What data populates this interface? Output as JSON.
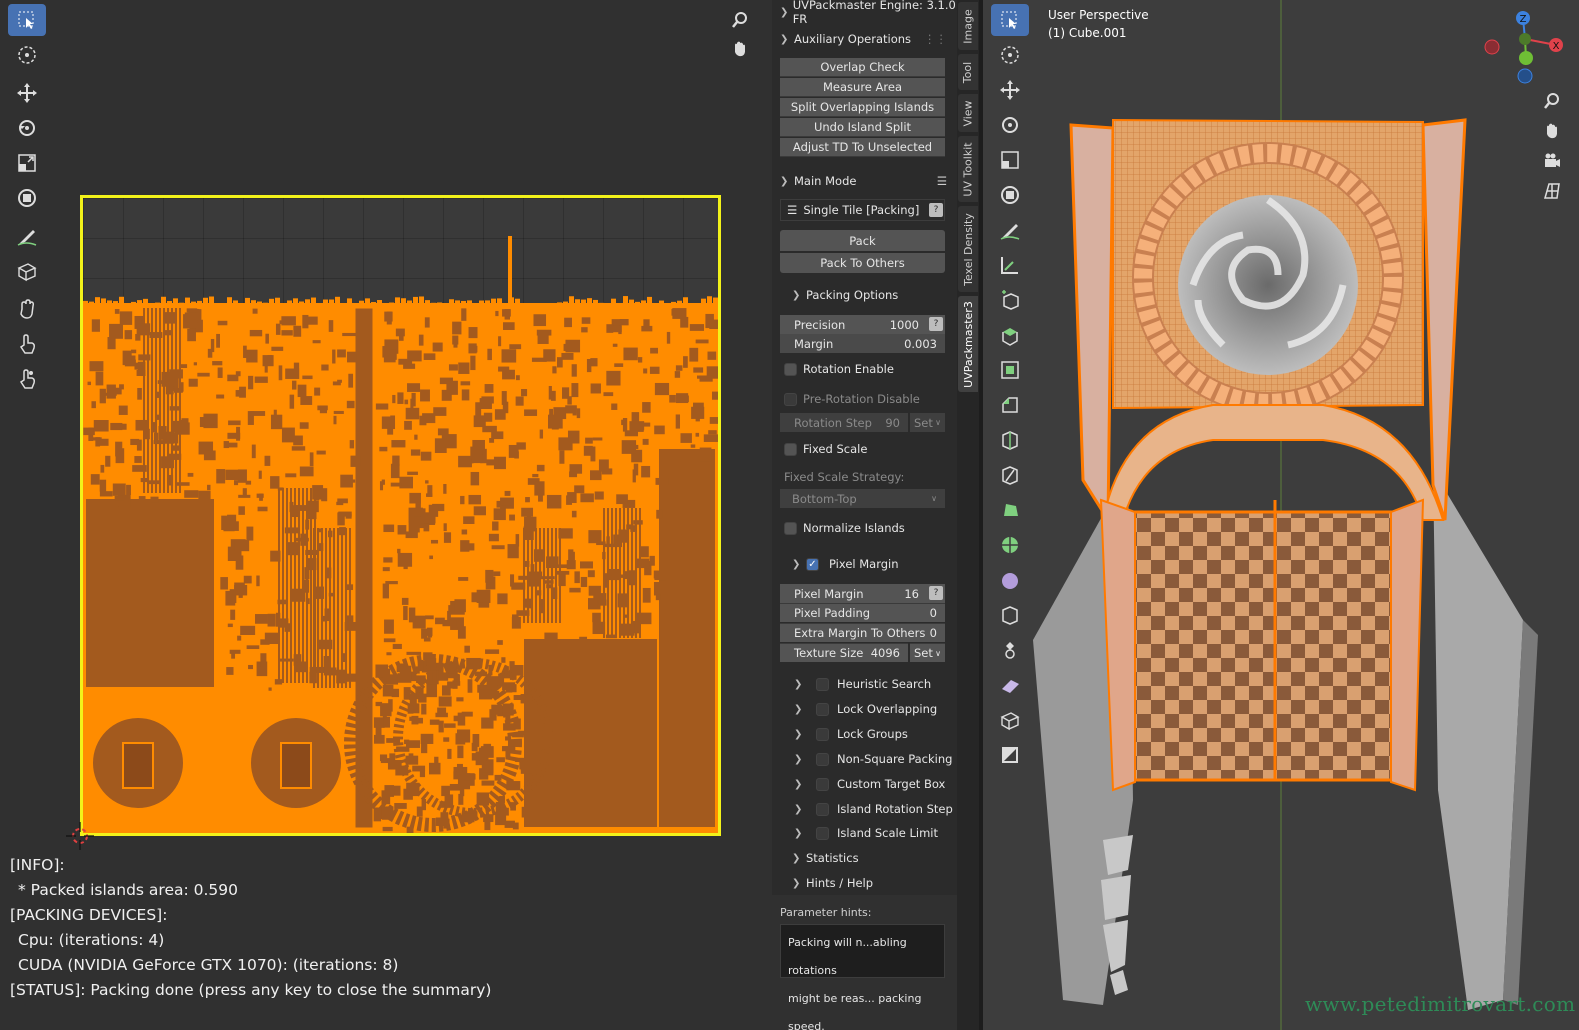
{
  "uv_editor": {
    "report": {
      "info_header": "[INFO]:",
      "packed_area": "* Packed islands area: 0.590",
      "devices_header": "[PACKING DEVICES]:",
      "cpu": "Cpu: (iterations: 4)",
      "cuda": "CUDA (NVIDIA GeForce GTX 1070): (iterations: 8)",
      "status": "[STATUS]: Packing done (press any key to close the summary)"
    },
    "tools": [
      "select-box-icon",
      "cursor-icon",
      "move-icon",
      "rotate-icon",
      "scale-icon",
      "transform-icon",
      "annotate-icon",
      "rip-region-icon",
      "grab-icon",
      "relax-icon",
      "pinch-icon"
    ],
    "colors": {
      "frame": "#f2f21a",
      "island": "#ff8c00",
      "island_dark": "#a35a1e"
    }
  },
  "panel": {
    "engine_header": "UVPackmaster Engine: 3.1.0 FR",
    "aux_header": "Auxiliary Operations",
    "aux_buttons": [
      "Overlap Check",
      "Measure Area",
      "Split Overlapping Islands",
      "Undo Island Split",
      "Adjust TD To Unselected"
    ],
    "main_mode_header": "Main Mode",
    "mode_select": "Single Tile [Packing]",
    "pack_button": "Pack",
    "pack_others_button": "Pack To Others",
    "packing_options_header": "Packing Options",
    "precision_label": "Precision",
    "precision_value": "1000",
    "margin_label": "Margin",
    "margin_value": "0.003",
    "rotation_enable": "Rotation Enable",
    "pre_rotation_disable": "Pre-Rotation Disable",
    "rotation_step_label": "Rotation Step",
    "rotation_step_value": "90",
    "set_label": "Set",
    "fixed_scale": "Fixed Scale",
    "fixed_scale_strategy": "Fixed Scale Strategy:",
    "strategy_value": "Bottom-Top",
    "normalize_islands": "Normalize Islands",
    "pixel_margin_header": "Pixel Margin",
    "pixel_margin_label": "Pixel Margin",
    "pixel_margin_value": "16",
    "pixel_padding_label": "Pixel Padding",
    "pixel_padding_value": "0",
    "extra_margin_label": "Extra Margin To Others",
    "extra_margin_value": "0",
    "texture_size_label": "Texture Size",
    "texture_size_value": "4096",
    "texture_set_label": "Set",
    "subpanels": [
      "Heuristic Search",
      "Lock Overlapping",
      "Lock Groups",
      "Non-Square Packing",
      "Custom Target Box",
      "Island Rotation Step",
      "Island Scale Limit"
    ],
    "statistics_header": "Statistics",
    "hints_header": "Hints / Help",
    "parameter_hints_label": "Parameter hints:",
    "hint_line1": "Packing will n...abling rotations",
    "hint_line2": "might be reas... packing speed."
  },
  "tabs": [
    "Image",
    "Tool",
    "View",
    "UV Toolkit",
    "Texel Density",
    "UVPackmaster3"
  ],
  "viewport": {
    "perspective": "User Perspective",
    "object": "(1) Cube.001",
    "watermark": "www.petedimitrovart.com",
    "axis_labels": {
      "z": "Z",
      "x": "X"
    },
    "colors": {
      "axis_x": "#e0424b",
      "axis_y": "#6fbf35",
      "axis_z": "#3c82e0",
      "selection": "#ff7a00",
      "mesh": "#c8c8c8"
    }
  }
}
